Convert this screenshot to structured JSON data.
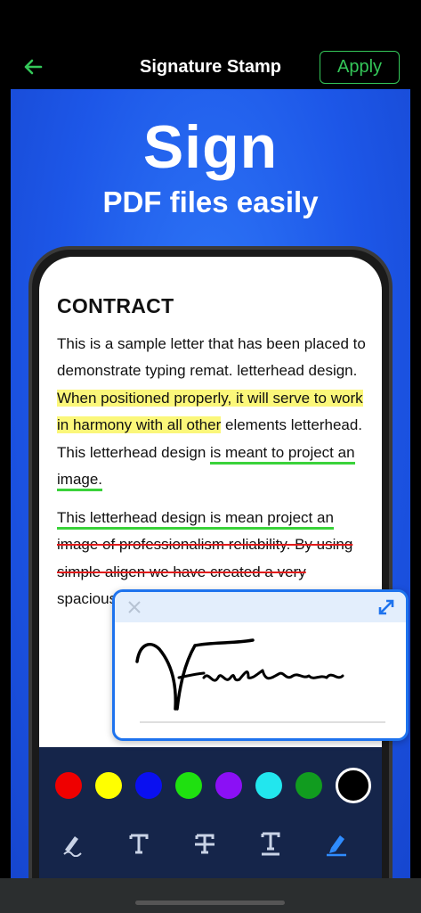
{
  "appbar": {
    "back_icon": "arrow-left-icon",
    "title": "Signature Stamp",
    "apply_label": "Apply",
    "accent_color": "#34c759"
  },
  "promo": {
    "headline": "Sign",
    "subheadline": "PDF files easily",
    "background_color": "#1d57e8"
  },
  "document": {
    "heading": "CONTRACT",
    "para1_plain": "This is a sample letter that has been placed to demonstrate typing remat. letterhead design. ",
    "para1_highlight": "When positioned properly, it will serve to work in harmony with all other",
    "para1_plain2": " elements letterhead. This letterhead design ",
    "para1_underline": "is meant to project an image.",
    "para2_underline": "This letterhead design is mean project an",
    "para2_strike": "image of professionalism reliability. By using simple aligen we have created a very",
    "para2_tail": " spacious regnthth haesthe"
  },
  "signature_popup": {
    "close_icon": "close-icon",
    "expand_icon": "expand-icon",
    "signature_text": "Franken"
  },
  "toolbar": {
    "colors": [
      "#ef0000",
      "#ffff00",
      "#0a10f0",
      "#1fe010",
      "#8b10f5",
      "#22e6ee",
      "#119c1f",
      "#000000"
    ],
    "selected_color": "#000000",
    "tools": [
      "draw-icon",
      "text-icon",
      "strikethrough-icon",
      "underline-icon",
      "signature-pen-icon"
    ],
    "active_tool": "signature-pen-icon"
  }
}
